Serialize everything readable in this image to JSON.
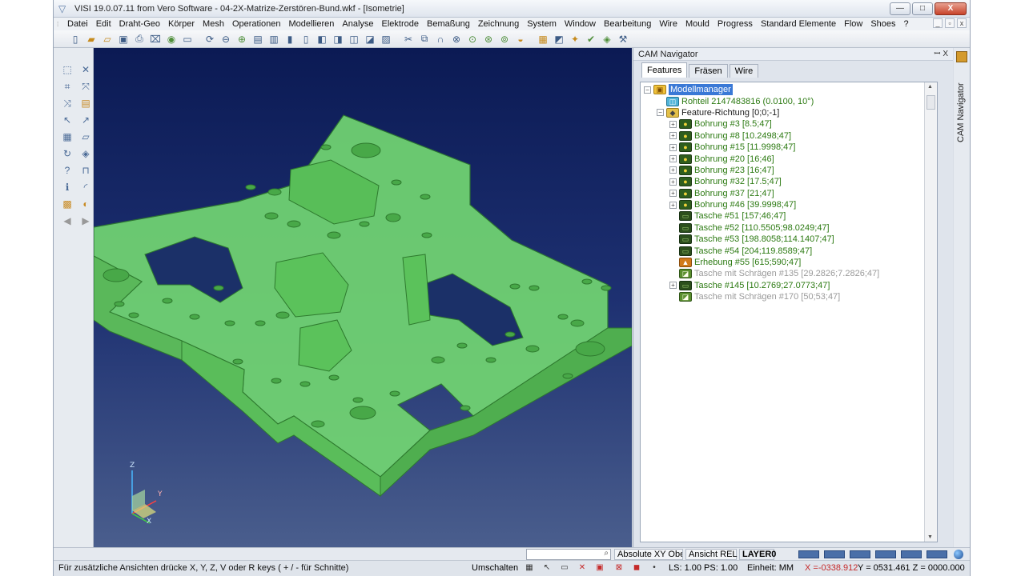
{
  "window": {
    "title": "VISI 19.0.07.11 from Vero Software - 04-2X-Matrize-Zerstören-Bund.wkf - [Isometrie]",
    "controls": {
      "minimize": "—",
      "maximize": "□",
      "close": "X"
    }
  },
  "menu": [
    "Datei",
    "Edit",
    "Draht-Geo",
    "Körper",
    "Mesh",
    "Operationen",
    "Modellieren",
    "Analyse",
    "Elektrode",
    "Bemaßung",
    "Zeichnung",
    "System",
    "Window",
    "Bearbeitung",
    "Wire",
    "Mould",
    "Progress",
    "Standard Elemente",
    "Flow",
    "Shoes",
    "?"
  ],
  "menu_window_controls": [
    "_",
    "▫",
    "x"
  ],
  "viewport": {
    "view_name": "Isometrie",
    "axis_labels": {
      "z": "Z",
      "y": "Y",
      "x": "X"
    },
    "colors": {
      "part_fill": "#6fd76f",
      "part_edge": "#2f7f2f",
      "bg_top": "#0b1a54",
      "bg_bottom": "#4a5e8d"
    }
  },
  "cam_navigator": {
    "title": "CAM Navigator",
    "title_controls": "ꟷ  X",
    "tabs": [
      {
        "label": "Features",
        "active": true
      },
      {
        "label": "Fräsen",
        "active": false
      },
      {
        "label": "Wire",
        "active": false
      }
    ],
    "tree": [
      {
        "label": "Modellmanager",
        "level": 0,
        "icon": "root",
        "expander": "−",
        "style": "sel"
      },
      {
        "label": "Rohteil 2147483816 (0.0100, 10°)",
        "level": 1,
        "icon": "part",
        "expander": "",
        "style": "normal"
      },
      {
        "label": "Feature-Richtung [0;0;-1]",
        "level": 1,
        "icon": "dir",
        "expander": "−",
        "style": "dark"
      },
      {
        "label": "Bohrung #3 [8.5;47]",
        "level": 2,
        "icon": "bore",
        "expander": "+",
        "style": "normal"
      },
      {
        "label": "Bohrung #8 [10.2498;47]",
        "level": 2,
        "icon": "bore",
        "expander": "+",
        "style": "normal"
      },
      {
        "label": "Bohrung #15 [11.9998;47]",
        "level": 2,
        "icon": "bore",
        "expander": "+",
        "style": "normal"
      },
      {
        "label": "Bohrung #20 [16;46]",
        "level": 2,
        "icon": "bore",
        "expander": "+",
        "style": "normal"
      },
      {
        "label": "Bohrung #23 [16;47]",
        "level": 2,
        "icon": "bore",
        "expander": "+",
        "style": "normal"
      },
      {
        "label": "Bohrung #32 [17.5;47]",
        "level": 2,
        "icon": "bore",
        "expander": "+",
        "style": "normal"
      },
      {
        "label": "Bohrung #37 [21;47]",
        "level": 2,
        "icon": "bore",
        "expander": "+",
        "style": "normal"
      },
      {
        "label": "Bohrung #46 [39.9998;47]",
        "level": 2,
        "icon": "bore",
        "expander": "+",
        "style": "normal"
      },
      {
        "label": "Tasche #51 [157;46;47]",
        "level": 2,
        "icon": "pocket",
        "expander": "",
        "style": "normal"
      },
      {
        "label": "Tasche #52 [110.5505;98.0249;47]",
        "level": 2,
        "icon": "pocket",
        "expander": "",
        "style": "normal"
      },
      {
        "label": "Tasche #53 [198.8058;114.1407;47]",
        "level": 2,
        "icon": "pocket",
        "expander": "",
        "style": "normal"
      },
      {
        "label": "Tasche #54 [204;119.8589;47]",
        "level": 2,
        "icon": "pocket",
        "expander": "",
        "style": "normal"
      },
      {
        "label": "Erhebung #55 [615;590;47]",
        "level": 2,
        "icon": "raise",
        "expander": "",
        "style": "normal"
      },
      {
        "label": "Tasche mit Schrägen #135 [29.2826;7.2826;47]",
        "level": 2,
        "icon": "slope",
        "expander": "",
        "style": "muted"
      },
      {
        "label": "Tasche #145 [10.2769;27.0773;47]",
        "level": 2,
        "icon": "pocket",
        "expander": "+",
        "style": "normal"
      },
      {
        "label": "Tasche mit Schrägen #170 [50;53;47]",
        "level": 2,
        "icon": "slope",
        "expander": "",
        "style": "muted"
      }
    ]
  },
  "side_tab": {
    "label": "CAM Navigator"
  },
  "status_bar": {
    "search_placeholder": "",
    "absolute_label": "Absolute XY Obe",
    "relative_label": "Ansicht REL",
    "layer_label": "LAYER0",
    "hint": "Für zusätzliche Ansichten drücke X, Y, Z, V oder R keys ( + / - für Schnitte)",
    "umschalten": "Umschalten",
    "ls_ps": "LS: 1.00 PS: 1.00",
    "unit": "Einheit: MM",
    "coord_x": "X =-0338.912",
    "coord_yz": "Y = 0531.461 Z = 0000.000"
  }
}
